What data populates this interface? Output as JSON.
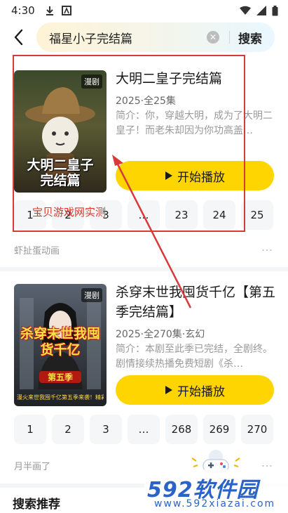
{
  "status_bar": {
    "time": "4:30"
  },
  "search": {
    "query": "福星小子完结篇",
    "button": "搜索"
  },
  "results": [
    {
      "cover_title": "大明二皇子完结篇",
      "badge": "漫剧",
      "title": "大明二皇子完结篇",
      "meta": "2025·全25集",
      "desc": "简介：你，穿越大明，成为了大明二皇子！而老朱却因为你功高盖…",
      "play": "开始播放",
      "episodes": [
        "1",
        "2",
        "3",
        "…",
        "23",
        "24",
        "25"
      ],
      "source": "虾扯蛋动画"
    },
    {
      "cover_title": "杀穿末世我囤货千亿",
      "cover_sub": "第五季",
      "cover_caption": "漫火来世我囤千亿第五季来袭！精彩继续！",
      "badge": "漫剧",
      "title": "杀穿末世我囤货千亿【第五季完结篇】",
      "meta": "2025·全270集·玄幻",
      "desc": "简介：本剧至此季已完结，全剧终。剧情接续热播免费短剧《杀…",
      "play": "开始播放",
      "episodes": [
        "1",
        "2",
        "3",
        "…",
        "268",
        "269",
        "270"
      ],
      "source": "月半画了"
    }
  ],
  "overlay_text": "宝贝游戏网实测",
  "section_title": "搜索推荐",
  "watermark": {
    "brand": "592软件园",
    "url": "www.592xiazai.com"
  },
  "colors": {
    "accent": "#ffd500",
    "annotation": "#d83a3a"
  }
}
